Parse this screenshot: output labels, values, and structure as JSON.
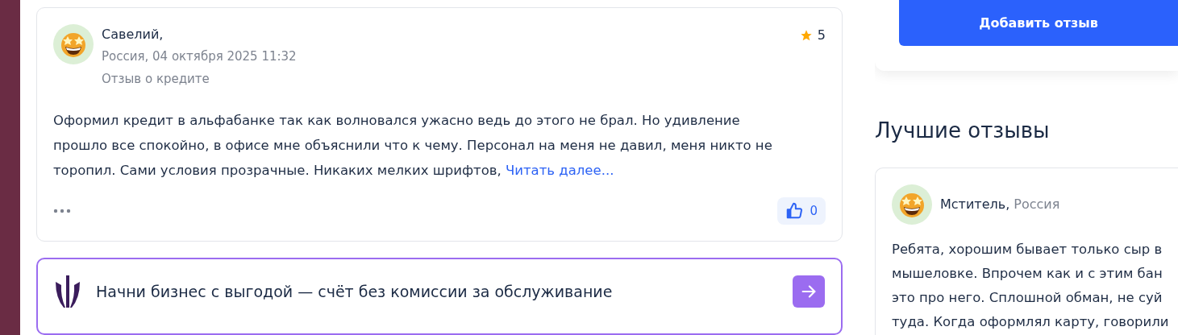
{
  "review": {
    "author": "Савелий,",
    "meta": "Россия, 04 октября 2025 11:32",
    "subject": "Отзыв о кредите",
    "rating": "5",
    "text": "Оформил кредит в альфабанке так как волновался ужасно ведь до этого не брал. Но удивление прошло все спокойно, в офисе мне объяснили что к чему. Персонал на меня не давил, меня никто не торопил. Сами условия прозрачные. Никаких мелких шрифтов,",
    "read_more": "Читать далее...",
    "likes": "0"
  },
  "promo": {
    "text": "Начни бизнес с выгодой — счёт без комиссии за обслуживание"
  },
  "sidebar": {
    "add_button": "Добавить отзыв",
    "best_title": "Лучшие отзывы",
    "best_review": {
      "author": "Мститель,",
      "country": "Россия",
      "text_lines": [
        "Ребята, хорошим бывает только сыр в",
        "мышеловке. Впрочем как и с этим бан",
        "это про него. Сплошной обман, не суй",
        "туда. Когда оформлял карту, говорили"
      ]
    }
  }
}
